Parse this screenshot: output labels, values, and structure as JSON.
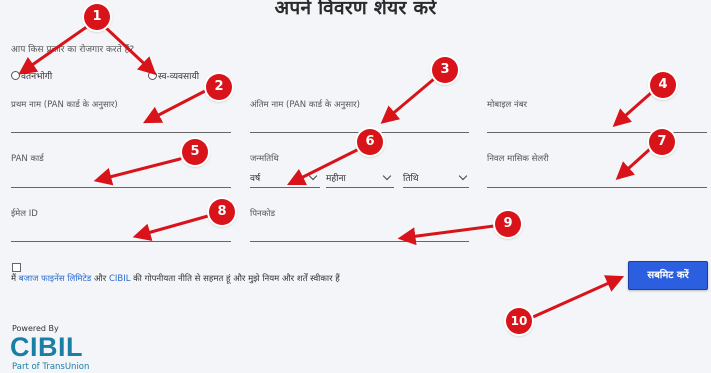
{
  "page": {
    "title": "अपने विवरण शेयर करें",
    "employment_question": "आप किस प्रकार का रोजगार करते हैं?"
  },
  "employment_options": [
    {
      "label": "वेतनभोगी",
      "selected": false
    },
    {
      "label": "स्व-व्यवसायी",
      "selected": false
    }
  ],
  "fields": {
    "first_name": {
      "label": "प्रथम नाम (PAN कार्ड के अनुसार)",
      "value": ""
    },
    "last_name": {
      "label": "अंतिम नाम (PAN कार्ड के अनुसार)",
      "value": ""
    },
    "mobile": {
      "label": "मोबाइल नंबर",
      "value": ""
    },
    "pan": {
      "label": "PAN कार्ड",
      "value": ""
    },
    "dob": {
      "label": "जन्मतिथि",
      "year": "वर्ष",
      "month": "महीना",
      "day": "तिथि"
    },
    "net_salary": {
      "label": "निवल मासिक सेलरी",
      "value": ""
    },
    "email": {
      "label": "ईमेल ID",
      "value": ""
    },
    "pincode": {
      "label": "पिनकोड",
      "value": ""
    }
  },
  "consent": {
    "checked": false,
    "prefix": "मैं",
    "link1": "बजाज फाइनेंस लिमिटेड",
    "mid": "और",
    "link2": "CIBIL",
    "suffix": "की गोपनीयता नीति से सहमत हूं और मुझे नियम और शर्तें स्वीकार हैं"
  },
  "submit_label": "सबमिट करें",
  "footer": {
    "powered_by": "Powered By",
    "brand": "CIBIL",
    "tagline": "Part of TransUnion"
  },
  "annotations": [
    "1",
    "2",
    "3",
    "4",
    "5",
    "6",
    "7",
    "8",
    "9",
    "10"
  ],
  "colors": {
    "accent_button": "#2b5fe0",
    "annotation_red": "#d8141a",
    "brand": "#1a7fa6",
    "link": "#2a6bd0"
  }
}
